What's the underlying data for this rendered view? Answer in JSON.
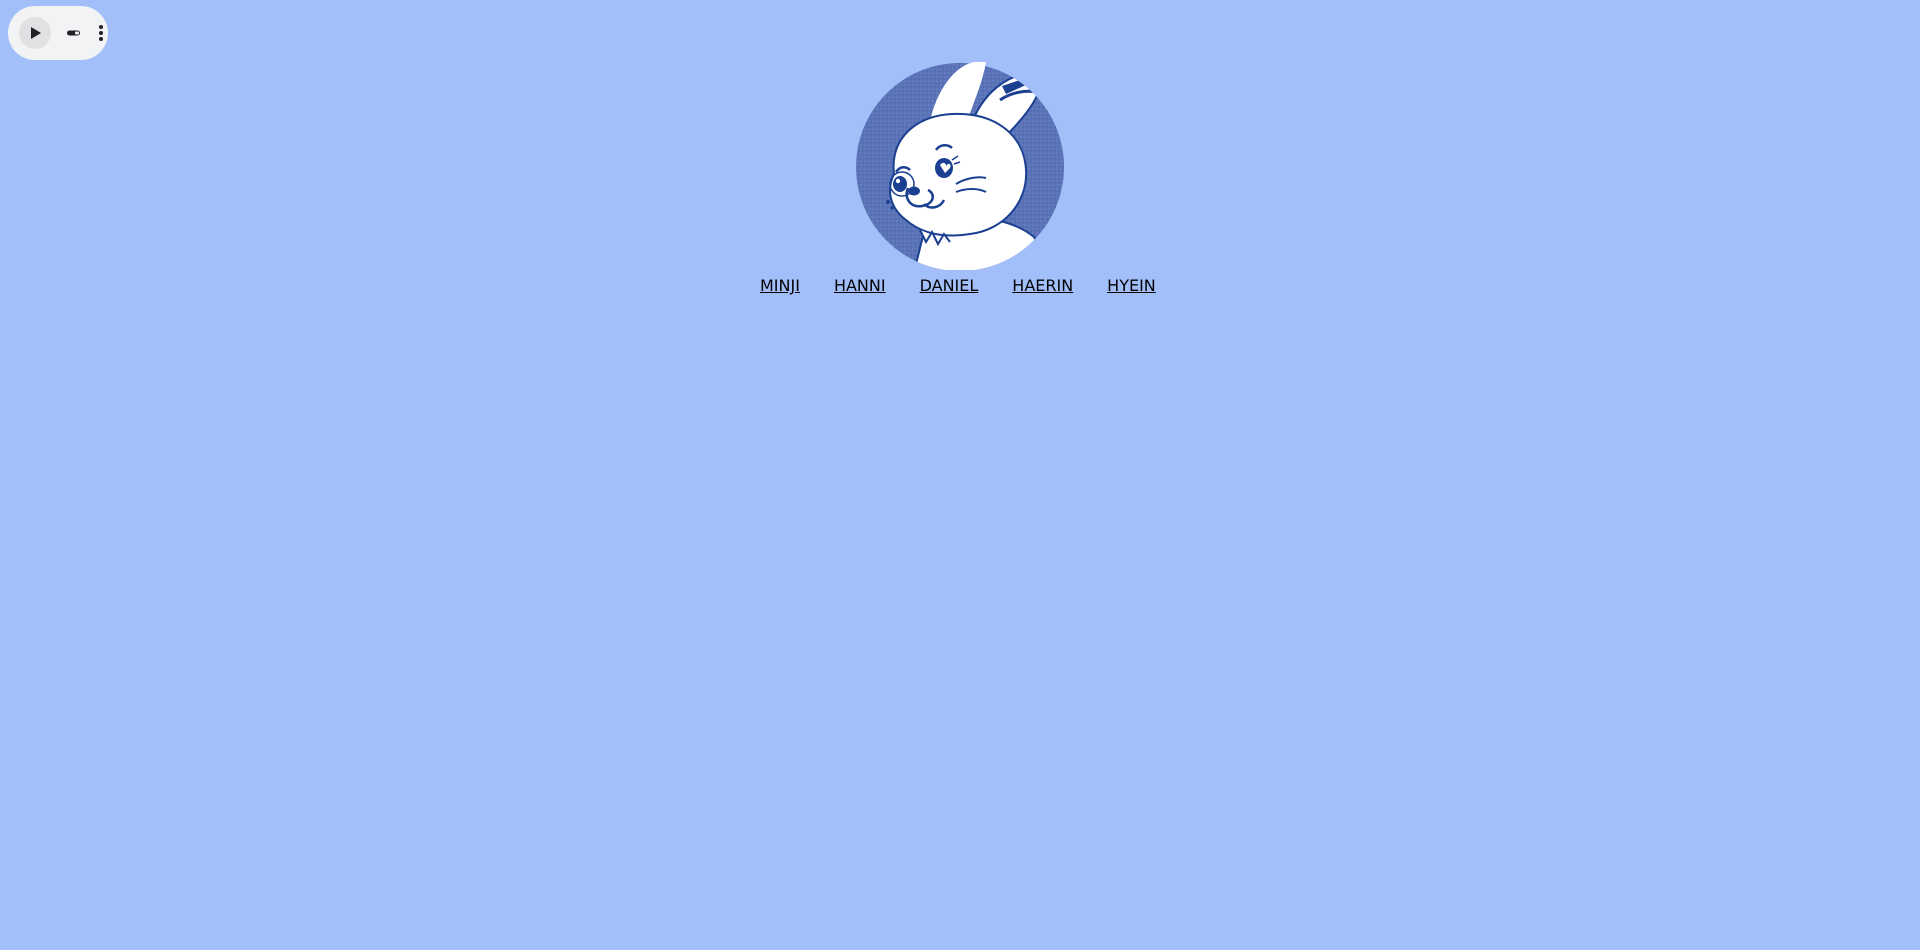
{
  "page": {
    "background_color": "#a3bffa"
  },
  "player": {
    "play_icon": "play-icon",
    "volume_icon": "volume-icon",
    "more_icon": "more-vertical-icon"
  },
  "mascot": {
    "icon": "bunny-mascot-icon",
    "circle_color": "#5b74b8",
    "ink_color": "#1b3f91"
  },
  "nav": {
    "items": [
      {
        "label": "MINJI"
      },
      {
        "label": "HANNI"
      },
      {
        "label": "DANIEL"
      },
      {
        "label": "HAERIN"
      },
      {
        "label": "HYEIN"
      }
    ]
  }
}
